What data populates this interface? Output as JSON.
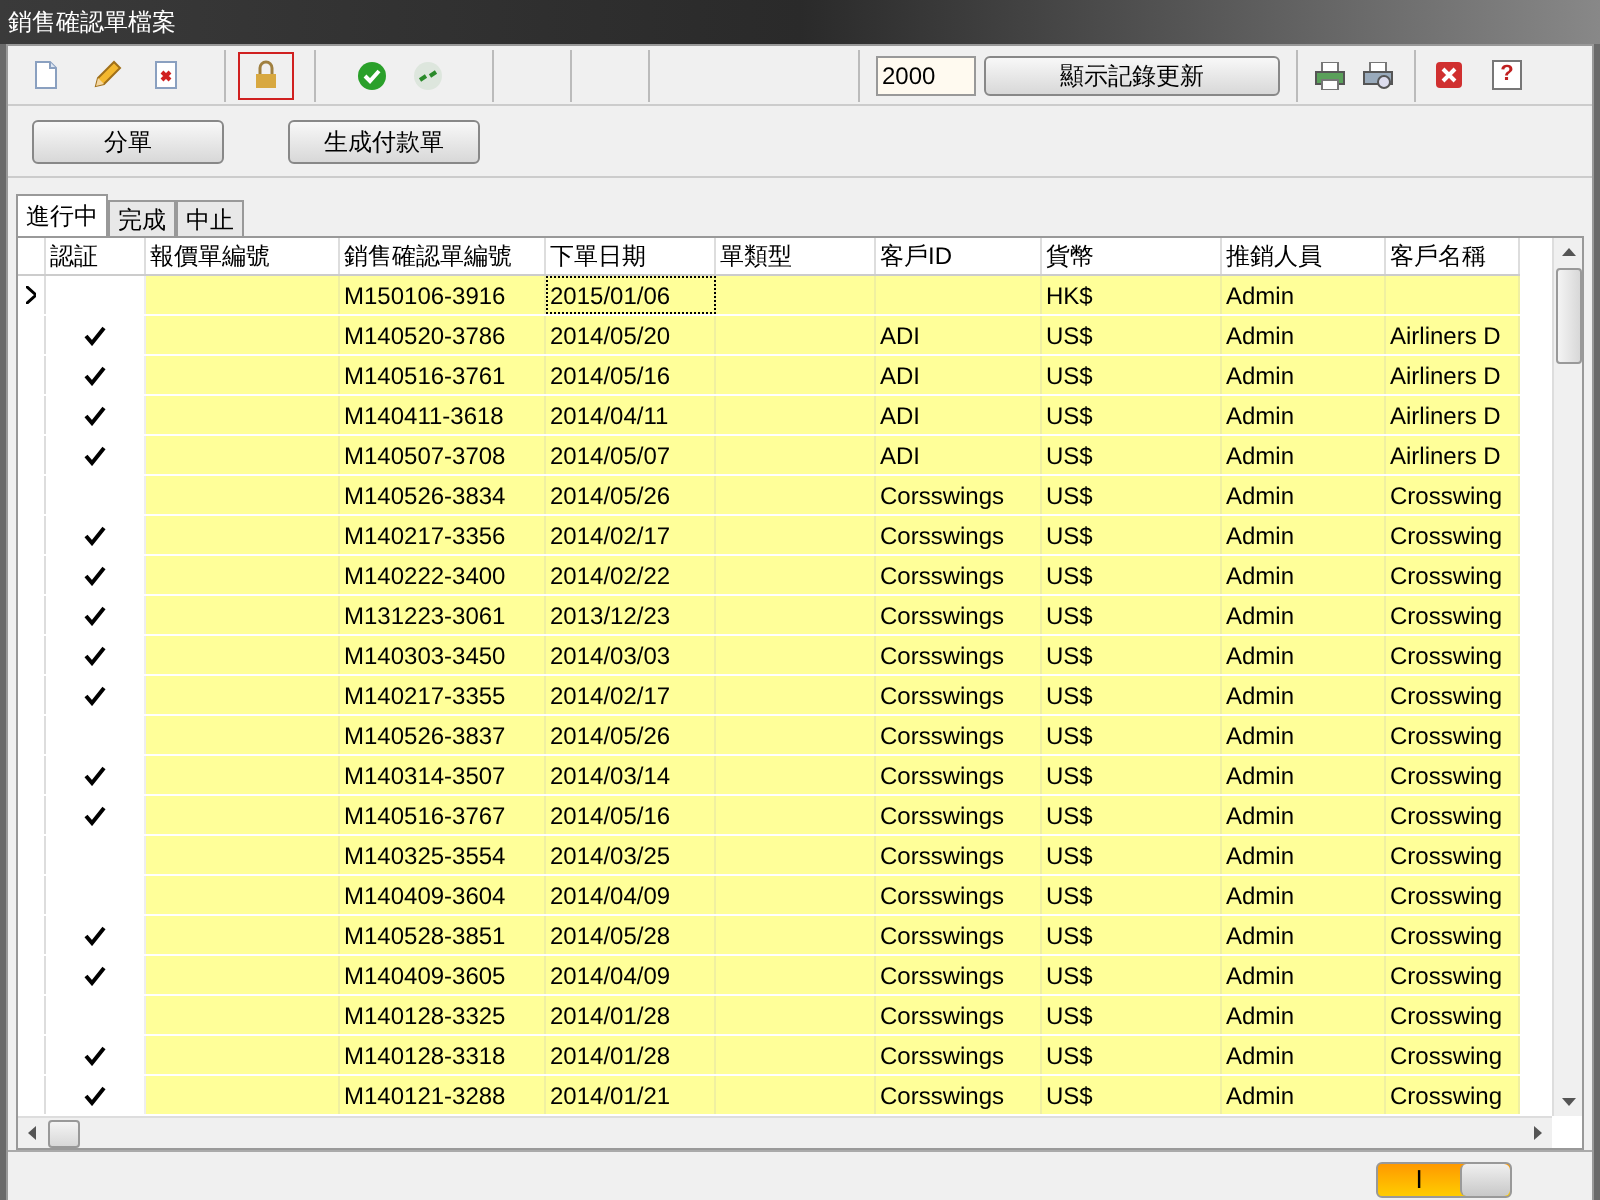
{
  "window": {
    "title": "銷售確認單檔案"
  },
  "toolbar": {
    "tools": [
      {
        "kind": "new",
        "selected": false
      },
      {
        "kind": "edit",
        "selected": false
      },
      {
        "kind": "delete",
        "selected": false
      },
      {
        "kind": "lock",
        "selected": true
      },
      {
        "kind": "approve",
        "selected": false
      },
      {
        "kind": "merge",
        "selected": false
      }
    ],
    "record_limit": "2000",
    "refresh_button": "顯示記錄更新",
    "help_label": "?"
  },
  "actions": [
    "分單",
    "生成付款單"
  ],
  "tabs": [
    {
      "label": "進行中",
      "selected": true
    },
    {
      "label": "完成",
      "selected": false
    },
    {
      "label": "中止",
      "selected": false
    }
  ],
  "table": {
    "columns": [
      "認証",
      "報價單編號",
      "銷售確認單編號",
      "下單日期",
      "單類型",
      "客戶ID",
      "貨幣",
      "推銷人員",
      "客戶名稱"
    ],
    "rows": [
      {
        "current": true,
        "verified": false,
        "order_no": "M150106-3916",
        "date": "2015/01/06",
        "currency": "HK$",
        "sales": "Admin"
      },
      {
        "current": false,
        "verified": true,
        "order_no": "M140520-3786",
        "date": "2014/05/20",
        "customer_id": "ADI",
        "currency": "US$",
        "sales": "Admin",
        "customer_name": "Airliners D"
      },
      {
        "current": false,
        "verified": true,
        "order_no": "M140516-3761",
        "date": "2014/05/16",
        "customer_id": "ADI",
        "currency": "US$",
        "sales": "Admin",
        "customer_name": "Airliners D"
      },
      {
        "current": false,
        "verified": true,
        "order_no": "M140411-3618",
        "date": "2014/04/11",
        "customer_id": "ADI",
        "currency": "US$",
        "sales": "Admin",
        "customer_name": "Airliners D"
      },
      {
        "current": false,
        "verified": true,
        "order_no": "M140507-3708",
        "date": "2014/05/07",
        "customer_id": "ADI",
        "currency": "US$",
        "sales": "Admin",
        "customer_name": "Airliners D"
      },
      {
        "current": false,
        "verified": false,
        "order_no": "M140526-3834",
        "date": "2014/05/26",
        "customer_id": "Corsswings",
        "currency": "US$",
        "sales": "Admin",
        "customer_name": "Crosswing"
      },
      {
        "current": false,
        "verified": true,
        "order_no": "M140217-3356",
        "date": "2014/02/17",
        "customer_id": "Corsswings",
        "currency": "US$",
        "sales": "Admin",
        "customer_name": "Crosswing"
      },
      {
        "current": false,
        "verified": true,
        "order_no": "M140222-3400",
        "date": "2014/02/22",
        "customer_id": "Corsswings",
        "currency": "US$",
        "sales": "Admin",
        "customer_name": "Crosswing"
      },
      {
        "current": false,
        "verified": true,
        "order_no": "M131223-3061",
        "date": "2013/12/23",
        "customer_id": "Corsswings",
        "currency": "US$",
        "sales": "Admin",
        "customer_name": "Crosswing"
      },
      {
        "current": false,
        "verified": true,
        "order_no": "M140303-3450",
        "date": "2014/03/03",
        "customer_id": "Corsswings",
        "currency": "US$",
        "sales": "Admin",
        "customer_name": "Crosswing"
      },
      {
        "current": false,
        "verified": true,
        "order_no": "M140217-3355",
        "date": "2014/02/17",
        "customer_id": "Corsswings",
        "currency": "US$",
        "sales": "Admin",
        "customer_name": "Crosswing"
      },
      {
        "current": false,
        "verified": false,
        "order_no": "M140526-3837",
        "date": "2014/05/26",
        "customer_id": "Corsswings",
        "currency": "US$",
        "sales": "Admin",
        "customer_name": "Crosswing"
      },
      {
        "current": false,
        "verified": true,
        "order_no": "M140314-3507",
        "date": "2014/03/14",
        "customer_id": "Corsswings",
        "currency": "US$",
        "sales": "Admin",
        "customer_name": "Crosswing"
      },
      {
        "current": false,
        "verified": true,
        "order_no": "M140516-3767",
        "date": "2014/05/16",
        "customer_id": "Corsswings",
        "currency": "US$",
        "sales": "Admin",
        "customer_name": "Crosswing"
      },
      {
        "current": false,
        "verified": false,
        "order_no": "M140325-3554",
        "date": "2014/03/25",
        "customer_id": "Corsswings",
        "currency": "US$",
        "sales": "Admin",
        "customer_name": "Crosswing"
      },
      {
        "current": false,
        "verified": false,
        "order_no": "M140409-3604",
        "date": "2014/04/09",
        "customer_id": "Corsswings",
        "currency": "US$",
        "sales": "Admin",
        "customer_name": "Crosswing"
      },
      {
        "current": false,
        "verified": true,
        "order_no": "M140528-3851",
        "date": "2014/05/28",
        "customer_id": "Corsswings",
        "currency": "US$",
        "sales": "Admin",
        "customer_name": "Crosswing"
      },
      {
        "current": false,
        "verified": true,
        "order_no": "M140409-3605",
        "date": "2014/04/09",
        "customer_id": "Corsswings",
        "currency": "US$",
        "sales": "Admin",
        "customer_name": "Crosswing"
      },
      {
        "current": false,
        "verified": false,
        "order_no": "M140128-3325",
        "date": "2014/01/28",
        "customer_id": "Corsswings",
        "currency": "US$",
        "sales": "Admin",
        "customer_name": "Crosswing"
      },
      {
        "current": false,
        "verified": true,
        "order_no": "M140128-3318",
        "date": "2014/01/28",
        "customer_id": "Corsswings",
        "currency": "US$",
        "sales": "Admin",
        "customer_name": "Crosswing"
      },
      {
        "current": false,
        "verified": true,
        "order_no": "M140121-3288",
        "date": "2014/01/21",
        "customer_id": "Corsswings",
        "currency": "US$",
        "sales": "Admin",
        "customer_name": "Crosswing"
      }
    ]
  },
  "status_bar": {
    "toggle": {
      "label": "I",
      "on": true
    }
  }
}
